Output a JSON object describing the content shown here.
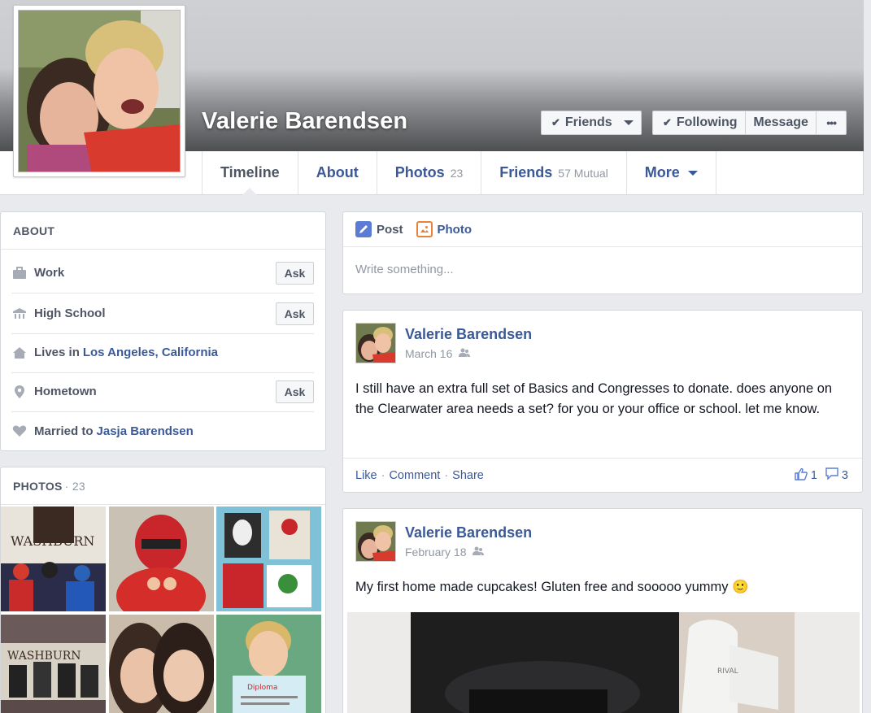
{
  "profile": {
    "name": "Valerie Barendsen"
  },
  "actions": {
    "friends_label": "Friends",
    "following_label": "Following",
    "message_label": "Message",
    "more_dots": "•••"
  },
  "tabs": [
    {
      "label": "Timeline",
      "count": ""
    },
    {
      "label": "About",
      "count": ""
    },
    {
      "label": "Photos",
      "count": "23"
    },
    {
      "label": "Friends",
      "count": "57 Mutual"
    },
    {
      "label": "More",
      "count": ""
    }
  ],
  "about": {
    "header": "ABOUT",
    "work": {
      "label": "Work",
      "button": "Ask"
    },
    "high_school": {
      "label": "High School",
      "button": "Ask"
    },
    "lives_in": {
      "prefix": "Lives in",
      "link": "Los Angeles, California"
    },
    "hometown": {
      "label": "Hometown",
      "button": "Ask"
    },
    "married": {
      "prefix": "Married to",
      "link": "Jasja Barendsen"
    }
  },
  "photos": {
    "header": "PHOTOS",
    "count": "· 23"
  },
  "composer": {
    "post_tab": "Post",
    "photo_tab": "Photo",
    "placeholder": "Write something..."
  },
  "posts": [
    {
      "author": "Valerie Barendsen",
      "date": "March 16",
      "text": "I still have an extra full set of Basics and Congresses to donate. does anyone on the Clearwater area needs a set? for you or your office or school. let me know.",
      "like": "Like",
      "comment": "Comment",
      "share": "Share",
      "sep": "·",
      "likes_count": "1",
      "comments_count": "3"
    },
    {
      "author": "Valerie Barendsen",
      "date": "February 18",
      "text": "My first home made cupcakes! Gluten free and sooooo yummy 🙂"
    }
  ],
  "colors": {
    "link": "#3b5998",
    "muted": "#9197a3",
    "page_bg": "#e9eaed"
  }
}
